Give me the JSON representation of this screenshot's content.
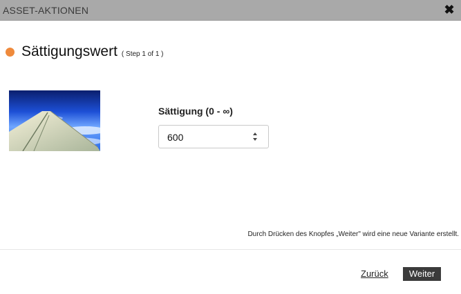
{
  "window": {
    "title": "ASSET-AKTIONEN",
    "close_icon": "close-icon"
  },
  "heading": {
    "title": "Sättigungswert",
    "step": "( Step 1 of 1 )",
    "accent_color": "#ef8a3c"
  },
  "preview": {
    "icon": "airplane-wing-photo"
  },
  "field": {
    "label": "Sättigung (0 - ∞)",
    "value": "600",
    "spinner_icon": "spinner-arrows-icon"
  },
  "footer": {
    "hint": "Durch Drücken des Knopfes „Weiter\" wird eine neue Variante erstellt.",
    "back_label": "Zurück",
    "next_label": "Weiter"
  }
}
